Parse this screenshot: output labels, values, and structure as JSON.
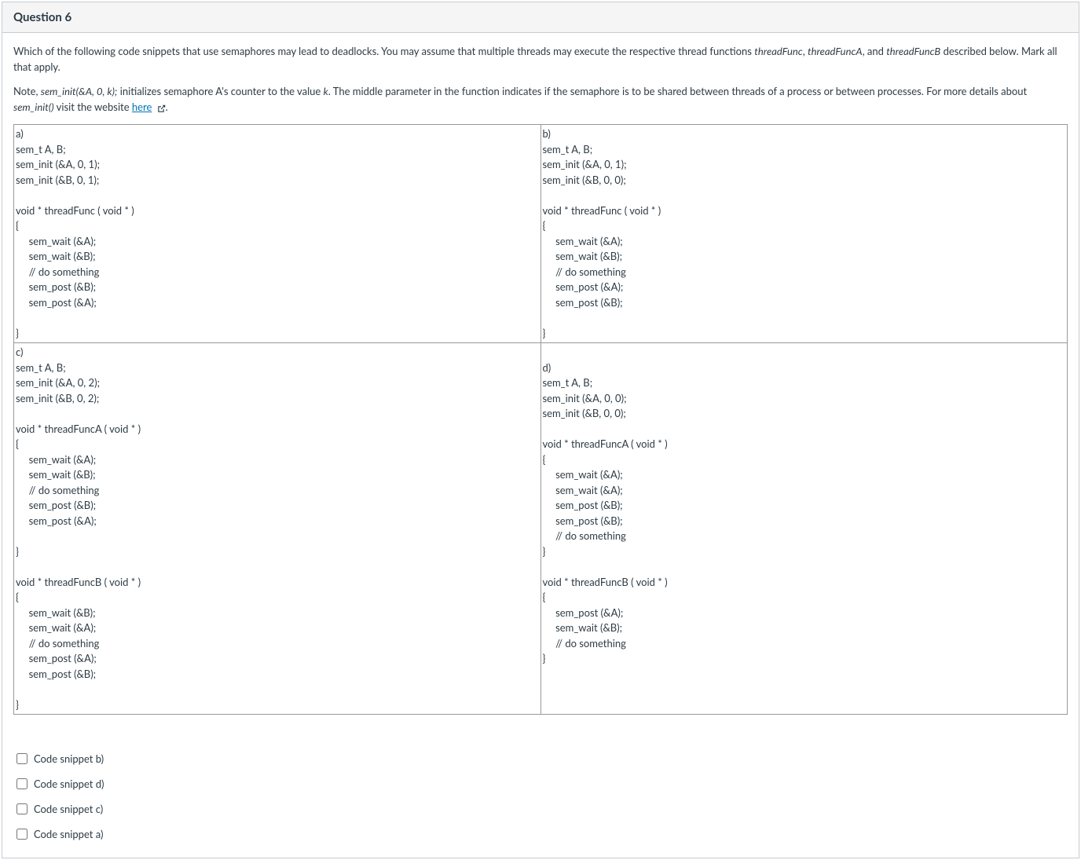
{
  "header": {
    "title": "Question 6"
  },
  "question": {
    "intro_pre": "Which of the following code snippets that use semaphores may lead to deadlocks. You may assume that multiple threads may execute the respective thread functions ",
    "tf1": "threadFunc",
    "sep1": ", ",
    "tf2": "threadFuncA",
    "sep2": ", and ",
    "tf3": "threadFuncB",
    "intro_post": " described below. Mark all that apply.",
    "note_pre": "Note, ",
    "note_call": "sem_init(&A, 0, k);",
    "note_mid1": " initializes semaphore A's counter to the value ",
    "note_k": "k",
    "note_mid2": ". The middle parameter in the function indicates if the semaphore is to be shared between threads of a process or between processes. For more details about ",
    "note_fn": "sem_init()",
    "note_post": " visit the website ",
    "link_text": "here"
  },
  "snippets": {
    "a": "a)\nsem_t A, B;\nsem_init (&A, 0, 1);\nsem_init (&B, 0, 1);\n\nvoid * threadFunc ( void * )\n{\n     sem_wait (&A);\n     sem_wait (&B);\n     // do something\n     sem_post (&B);\n     sem_post (&A);\n\n}",
    "b": "b)\nsem_t A, B;\nsem_init (&A, 0, 1);\nsem_init (&B, 0, 0);\n\nvoid * threadFunc ( void * )\n{\n     sem_wait (&A);\n     sem_wait (&B);\n     // do something\n     sem_post (&A);\n     sem_post (&B);\n\n}",
    "c": "c)\nsem_t A, B;\nsem_init (&A, 0, 2);\nsem_init (&B, 0, 2);\n\nvoid * threadFuncA ( void * )\n{\n     sem_wait (&A);\n     sem_wait (&B);\n     // do something\n     sem_post (&B);\n     sem_post (&A);\n\n}\n\nvoid * threadFuncB ( void * )\n{\n     sem_wait (&B);\n     sem_wait (&A);\n     // do something\n     sem_post (&A);\n     sem_post (&B);\n\n}",
    "d": "\nd)\nsem_t A, B;\nsem_init (&A, 0, 0);\nsem_init (&B, 0, 0);\n\nvoid * threadFuncA ( void * )\n{\n     sem_wait (&A);\n     sem_wait (&A);\n     sem_post (&B);\n     sem_post (&B);\n     // do something\n}\n\nvoid * threadFuncB ( void * )\n{\n     sem_post (&A);\n     sem_wait (&B);\n     // do something\n}"
  },
  "answers": [
    {
      "label": "Code snippet b)"
    },
    {
      "label": "Code snippet d)"
    },
    {
      "label": "Code snippet c)"
    },
    {
      "label": "Code snippet a)"
    }
  ]
}
